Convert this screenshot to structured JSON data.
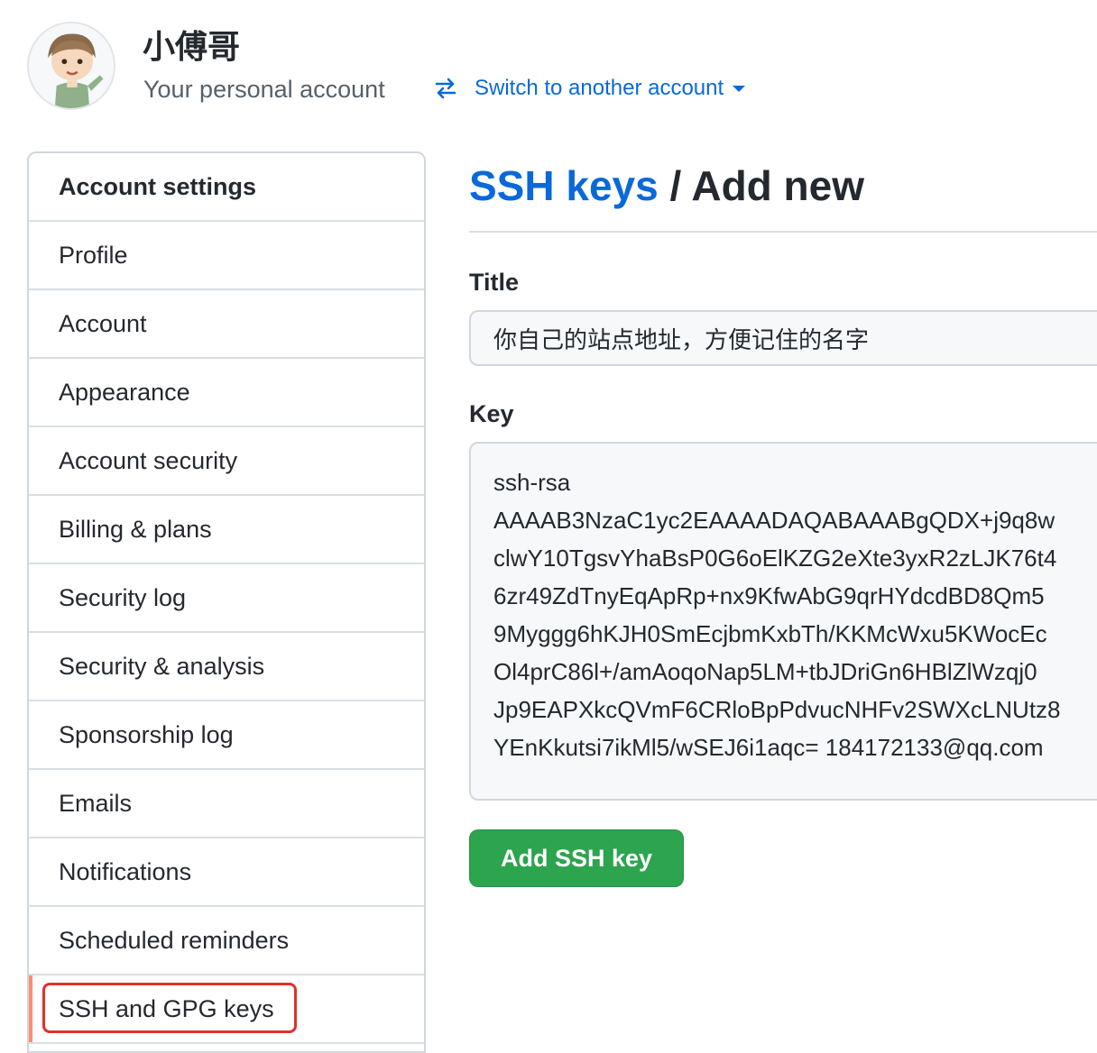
{
  "header": {
    "user_name": "小傅哥",
    "subtitle": "Your personal account",
    "switch_label": "Switch to another account"
  },
  "sidebar": {
    "heading": "Account settings",
    "items": [
      {
        "label": "Profile"
      },
      {
        "label": "Account"
      },
      {
        "label": "Appearance"
      },
      {
        "label": "Account security"
      },
      {
        "label": "Billing & plans"
      },
      {
        "label": "Security log"
      },
      {
        "label": "Security & analysis"
      },
      {
        "label": "Sponsorship log"
      },
      {
        "label": "Emails"
      },
      {
        "label": "Notifications"
      },
      {
        "label": "Scheduled reminders"
      },
      {
        "label": "SSH and GPG keys",
        "selected": true
      }
    ]
  },
  "main": {
    "breadcrumb_link": "SSH keys",
    "breadcrumb_sep": " / ",
    "breadcrumb_current": "Add new",
    "title_label": "Title",
    "title_value": "你自己的站点地址，方便记住的名字",
    "key_label": "Key",
    "key_lines": [
      "ssh-rsa",
      "AAAAB3NzaC1yc2EAAAADAQABAAABgQDX+j9q8w",
      "clwY10TgsvYhaBsP0G6oElKZG2eXte3yxR2zLJK76t4",
      "6zr49ZdTnyEqApRp+nx9KfwAbG9qrHYdcdBD8Qm5",
      "9Myggg6hKJH0SmEcjbmKxbTh/KKMcWxu5KWocEc",
      "Ol4prC86l+/amAoqoNap5LM+tbJDriGn6HBlZlWzqj0",
      "Jp9EAPXkcQVmF6CRloBpPdvucNHFv2SWXcLNUtz8",
      "YEnKkutsi7ikMl5/wSEJ6i1aqc= 184172133@qq.com"
    ],
    "submit_label": "Add SSH key"
  },
  "colors": {
    "link": "#0969da",
    "primary_button": "#2da44e",
    "selected_indicator": "#fd8c73",
    "highlight_box": "#e0312b"
  },
  "icons": {
    "switch": "arrow-switch-icon",
    "caret": "caret-down-icon",
    "avatar": "avatar"
  }
}
